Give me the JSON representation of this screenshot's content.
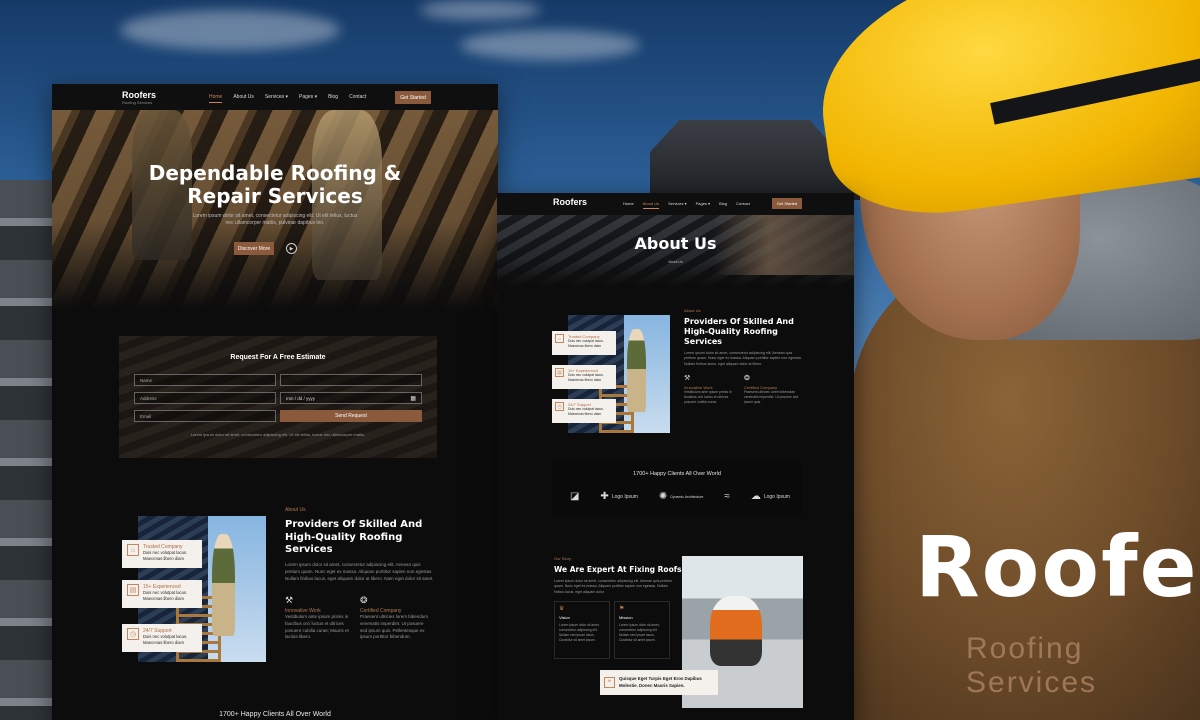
{
  "brand": {
    "title": "Roofers",
    "tagline": "Roofing Services"
  },
  "home": {
    "nav": {
      "logo": "Roofers",
      "logo_sub": "Roofing Services",
      "items": [
        "Home",
        "About Us",
        "Services ▾",
        "Pages ▾",
        "Blog",
        "Contact"
      ],
      "active": "Home",
      "cta": "Get Started"
    },
    "hero": {
      "title_line1": "Dependable Roofing &",
      "title_line2": "Repair Services",
      "desc": "Lorem ipsum dolor sit amet, consectetur adipiscing elit. Ut elit tellus, luctus nec ullamcorper mattis, pulvinar dapibus leo.",
      "button": "Discover More"
    },
    "estimate": {
      "title": "Request For A Free Estimate",
      "fields": {
        "name": "Name",
        "phone": "",
        "address": "Address",
        "date": "mm / dd / yyyy",
        "email": "Email"
      },
      "submit": "Send Request",
      "footnote": "Lorem ipsum dolor sit amet, consectetur adipiscing elit. Ut elit tellus, luctus nec ullamcorper mattis."
    },
    "about": {
      "eyebrow": "About Us",
      "title_line1": "Providers Of Skilled And",
      "title_line2": "High-Quality Roofing",
      "title_line3": "Services",
      "text": "Lorem ipsum dolor sit amet, consectetur adipiscing elit. Aenean quis pretium quam. Nunc eget ex massa. Aliquam porttitor sapien non egestas. Nullam finibus lacus, eget aliquam dolor at libero. Nam eget dolor sit amet.",
      "features": [
        {
          "icon": "tools-icon",
          "title": "Innovative Work",
          "text": "Vestibulum ante ipsum primis in faucibus orci luctus et ultrices posuere cubilia curae; Mauris et lacinia libero."
        },
        {
          "icon": "award-icon",
          "title": "Certified Company",
          "text": "Praesent ultricies lorem bibendum venenatis imperdiet. Ut posuere sed ipsum quis. Pellentesque ex ipsum porttitor bibendum."
        }
      ],
      "badges": [
        {
          "icon": "house-icon",
          "title": "Trusted Company",
          "text": "Duis nec volutpat lacus. Maecenas libero diam"
        },
        {
          "icon": "calendar-icon",
          "title": "15+ Experienced",
          "text": "Duis nec volutpat lacus. Maecenas libero diam"
        },
        {
          "icon": "clock-icon",
          "title": "24/7 Support",
          "text": "Duis nec volutpat lacus. Maecenas libero diam"
        }
      ]
    },
    "clients_title": "1700+ Happy Clients All Over World"
  },
  "about_page": {
    "nav": {
      "logo": "Roofers",
      "logo_sub": "Roofing Services",
      "items": [
        "Home",
        "About Us",
        "Services ▾",
        "Pages ▾",
        "Blog",
        "Contact"
      ],
      "active": "About Us",
      "cta": "Get Started"
    },
    "hero": {
      "title": "About Us",
      "breadcrumb": "About Us"
    },
    "about": {
      "eyebrow": "About Us",
      "title_line1": "Providers Of Skilled And",
      "title_line2": "High-Quality Roofing",
      "title_line3": "Services",
      "text": "Lorem ipsum dolor sit amet, consectetur adipiscing elit. Aenean quis pretium quam. Nunc eget ex massa. Aliquam porttitor sapien non egestas. Nullam finibus lacus, eget aliquam dolor at libero.",
      "features": [
        {
          "icon": "tools-icon",
          "title": "Innovative Work",
          "text": "Vestibulum ante ipsum primis in faucibus orci luctus et ultrices posuere cubilia curae."
        },
        {
          "icon": "award-icon",
          "title": "Certified Company",
          "text": "Praesent ultricies lorem bibendum venenatis imperdiet. Ut posuere sed ipsum quis."
        }
      ],
      "badges": [
        {
          "icon": "house-icon",
          "title": "Trusted Company",
          "text": "Duis nec volutpat lacus. Maecenas libero diam"
        },
        {
          "icon": "calendar-icon",
          "title": "15+ Experienced",
          "text": "Duis nec volutpat lacus. Maecenas libero diam"
        },
        {
          "icon": "clock-icon",
          "title": "24/7 Support",
          "text": "Duis nec volutpat lacus. Maecenas libero diam"
        }
      ]
    },
    "clients": {
      "title": "1700+ Happy Clients All Over World",
      "logos": [
        "Logo",
        "Logo Ipsum",
        "Dynamic Architecture",
        "Logo",
        "Logo Ipsum"
      ]
    },
    "expert": {
      "eyebrow": "Our Story",
      "title": "We Are Expert At Fixing Roofs",
      "text": "Lorem ipsum dolor sit amet, consectetur adipiscing elit. Aenean quis pretium quam. Nunc eget ex massa. Aliquam porttitor sapien non egestas. Nullam finibus lacus, eget aliquam dolor.",
      "cards": [
        {
          "icon": "trophy-icon",
          "title": "Vision",
          "text": "Lorem ipsum dolor sit amet, consectetur adipiscing elit. Nullam sed ipsum lacus. Curabitur sit amet ipsum."
        },
        {
          "icon": "flag-icon",
          "title": "Mission",
          "text": "Lorem ipsum dolor sit amet, consectetur adipiscing elit. Nullam sed ipsum lacus. Curabitur sit amet ipsum."
        }
      ],
      "quote_line1": "Quisque Eget Turpis Eget Eros Dapibus",
      "quote_line2": "Molestie. Donec Mauris Sapien."
    }
  },
  "colors": {
    "accent": "#8b5a3c",
    "accent_text": "#b57a52",
    "page_bg": "#0c0c0c",
    "helmet": "#f1b500"
  }
}
